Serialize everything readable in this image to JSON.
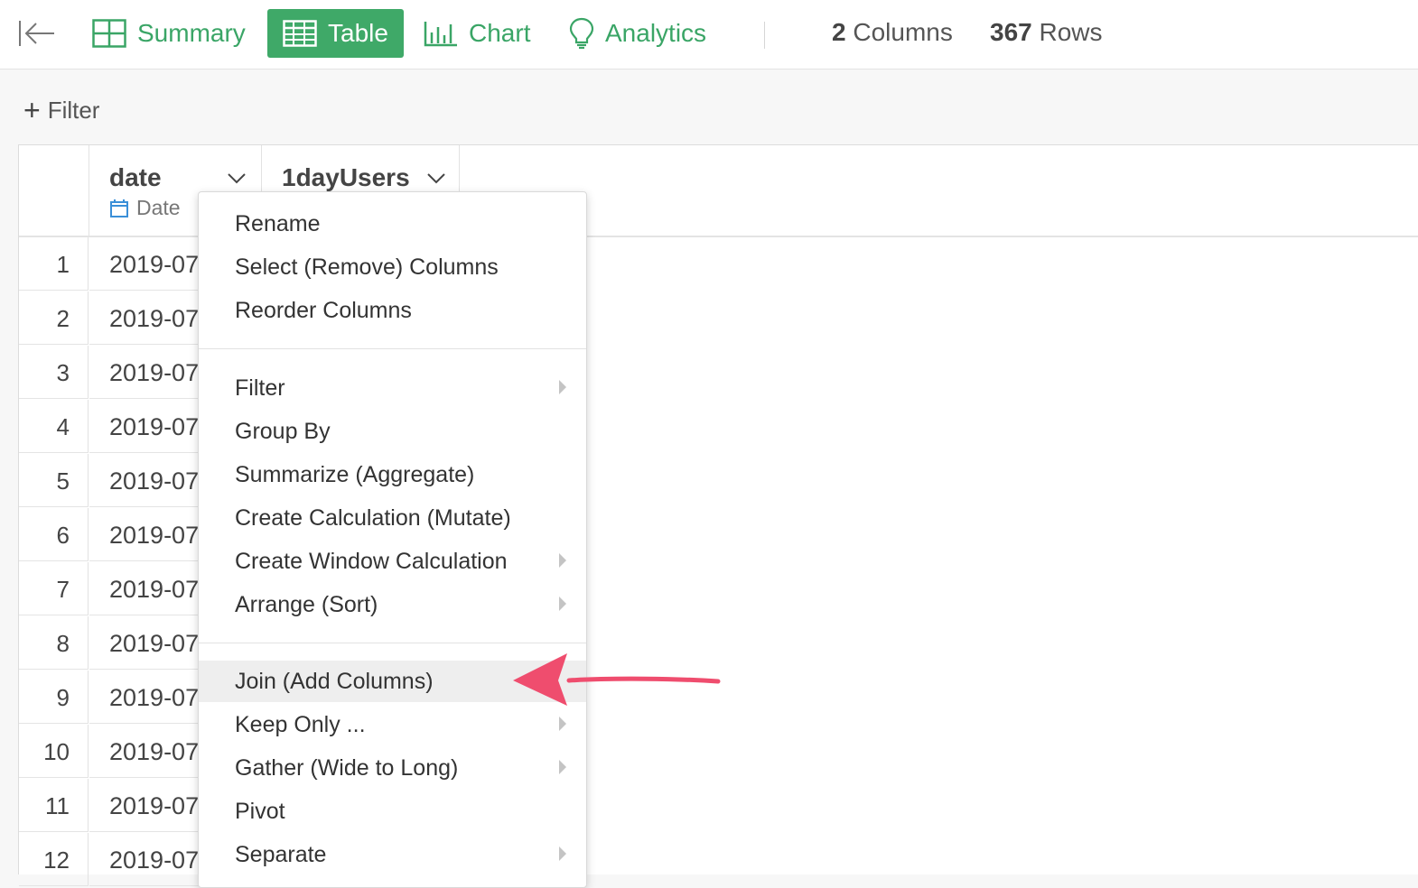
{
  "toolbar": {
    "tabs": [
      {
        "label": "Summary",
        "icon": "grid-icon"
      },
      {
        "label": "Table",
        "icon": "table-icon",
        "active": true
      },
      {
        "label": "Chart",
        "icon": "bar-chart-icon"
      },
      {
        "label": "Analytics",
        "icon": "lightbulb-icon"
      }
    ],
    "columns_count": "2",
    "columns_label": "Columns",
    "rows_count": "367",
    "rows_label": "Rows"
  },
  "filter": {
    "label": "Filter"
  },
  "table": {
    "columns": [
      {
        "name": "date",
        "type": "Date"
      },
      {
        "name": "1dayUsers",
        "type": ""
      }
    ],
    "rows": [
      {
        "index": "1",
        "date": "2019-07"
      },
      {
        "index": "2",
        "date": "2019-07"
      },
      {
        "index": "3",
        "date": "2019-07"
      },
      {
        "index": "4",
        "date": "2019-07"
      },
      {
        "index": "5",
        "date": "2019-07"
      },
      {
        "index": "6",
        "date": "2019-07"
      },
      {
        "index": "7",
        "date": "2019-07"
      },
      {
        "index": "8",
        "date": "2019-07"
      },
      {
        "index": "9",
        "date": "2019-07"
      },
      {
        "index": "10",
        "date": "2019-07"
      },
      {
        "index": "11",
        "date": "2019-07"
      },
      {
        "index": "12",
        "date": "2019-07"
      }
    ]
  },
  "menu": {
    "items": [
      {
        "label": "Rename"
      },
      {
        "label": "Select (Remove) Columns"
      },
      {
        "label": "Reorder Columns"
      },
      {
        "label": "Filter",
        "submenu": true
      },
      {
        "label": "Group By"
      },
      {
        "label": "Summarize (Aggregate)"
      },
      {
        "label": "Create Calculation (Mutate)"
      },
      {
        "label": "Create Window Calculation",
        "submenu": true
      },
      {
        "label": "Arrange (Sort)",
        "submenu": true
      },
      {
        "label": "Join (Add Columns)",
        "highlighted": true
      },
      {
        "label": "Keep Only ...",
        "submenu": true
      },
      {
        "label": "Gather (Wide to Long)",
        "submenu": true
      },
      {
        "label": "Pivot"
      },
      {
        "label": "Separate",
        "submenu": true
      }
    ]
  },
  "colors": {
    "accent": "#3fa968",
    "annotation": "#ef4d6e"
  }
}
